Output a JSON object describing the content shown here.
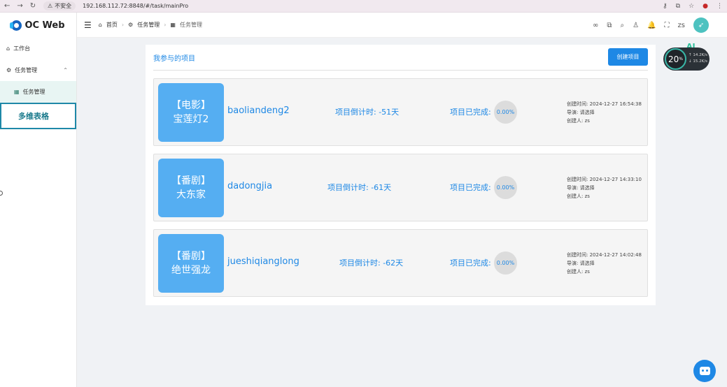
{
  "browser": {
    "nav_back": "←",
    "nav_forward": "→",
    "nav_reload": "↻",
    "insecure_label": "不安全",
    "url": "192.168.112.72:8848/#/task/mainPro"
  },
  "sidebar": {
    "logo_text": "OC Web",
    "items": [
      {
        "label": "工作台",
        "icon": "home-icon"
      },
      {
        "label": "任务管理",
        "icon": "gear-icon"
      },
      {
        "label": "任务管理",
        "icon": "grid-icon"
      },
      {
        "label": "多维表格"
      }
    ]
  },
  "header": {
    "breadcrumb": [
      "首页",
      "任务管理",
      "任务管理"
    ],
    "user": "zs"
  },
  "main": {
    "title": "我参与的项目",
    "create_button": "创建项目",
    "done_label": "项目已完成:",
    "projects": [
      {
        "type": "【电影】",
        "name_cn": "宝莲灯2",
        "name": "baoliandeng2",
        "countdown": "项目倒计时: -51天",
        "progress": "0.00%",
        "created": "创建时间: 2024-12-27 16:54:38",
        "director": "导演: 请选择",
        "creator": "创建人: zs"
      },
      {
        "type": "【番剧】",
        "name_cn": "大东家",
        "name": "dadongjia",
        "countdown": "项目倒计时: -61天",
        "progress": "0.00%",
        "created": "创建时间: 2024-12-27 14:33:10",
        "director": "导演: 请选择",
        "creator": "创建人: zs"
      },
      {
        "type": "【番剧】",
        "name_cn": "绝世强龙",
        "name": "jueshiqianglong",
        "countdown": "项目倒计时: -62天",
        "progress": "0.00%",
        "created": "创建时间: 2024-12-27 14:02:48",
        "director": "导演: 请选择",
        "creator": "创建人: zs"
      }
    ]
  },
  "widget": {
    "ai": "AI",
    "percent": "20",
    "percent_unit": "%",
    "up": "↑ 14.2K/s",
    "down": "↓ 15.2K/s"
  },
  "colors": {
    "accent": "#1e88e5",
    "cover": "#55aef2",
    "sidebar_active_bg": "#e8f5f3"
  }
}
